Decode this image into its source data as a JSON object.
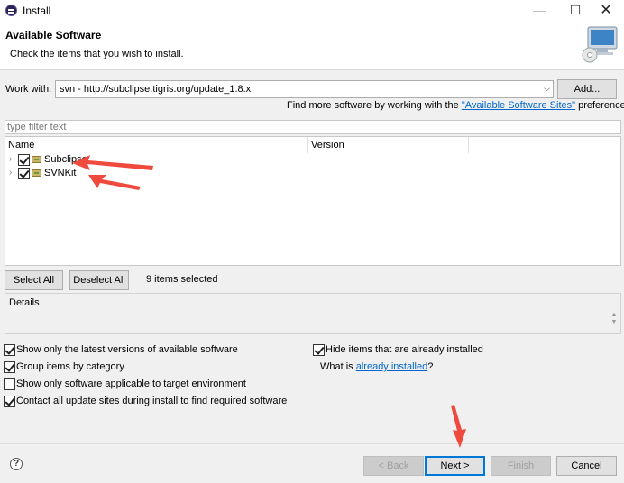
{
  "window": {
    "title": "Install"
  },
  "header": {
    "title": "Available Software",
    "subtitle": "Check the items that you wish to install."
  },
  "work_with": {
    "label": "Work with:",
    "value": "svn - http://subclipse.tigris.org/update_1.8.x",
    "add_label": "Add..."
  },
  "find_more": {
    "prefix": "Find more software by working with the ",
    "link": "\"Available Software Sites\"",
    "suffix": " preferences."
  },
  "filter": {
    "placeholder": "type filter text"
  },
  "tree": {
    "columns": [
      "Name",
      "Version"
    ],
    "items": [
      {
        "label": "Subclipse",
        "checked": true
      },
      {
        "label": "SVNKit",
        "checked": true
      }
    ]
  },
  "selection": {
    "select_all": "Select All",
    "deselect_all": "Deselect All",
    "status": "9 items selected"
  },
  "details": {
    "label": "Details"
  },
  "options": {
    "latest_versions": {
      "label": "Show only the latest versions of available software",
      "checked": true
    },
    "group_by_category": {
      "label": "Group items by category",
      "checked": true
    },
    "applicable_only": {
      "label": "Show only software applicable to target environment",
      "checked": false
    },
    "contact_sites": {
      "label": "Contact all update sites during install to find required software",
      "checked": true
    },
    "hide_installed": {
      "label": "Hide items that are already installed",
      "checked": true
    },
    "what_is_prefix": "What is ",
    "what_is_link": "already installed",
    "what_is_suffix": "?"
  },
  "footer": {
    "back": "< Back",
    "next": "Next >",
    "finish": "Finish",
    "cancel": "Cancel",
    "help": "?"
  },
  "colors": {
    "accent": "#0078d7",
    "link": "#0066cc",
    "annotation_arrow": "#f04a3e"
  }
}
